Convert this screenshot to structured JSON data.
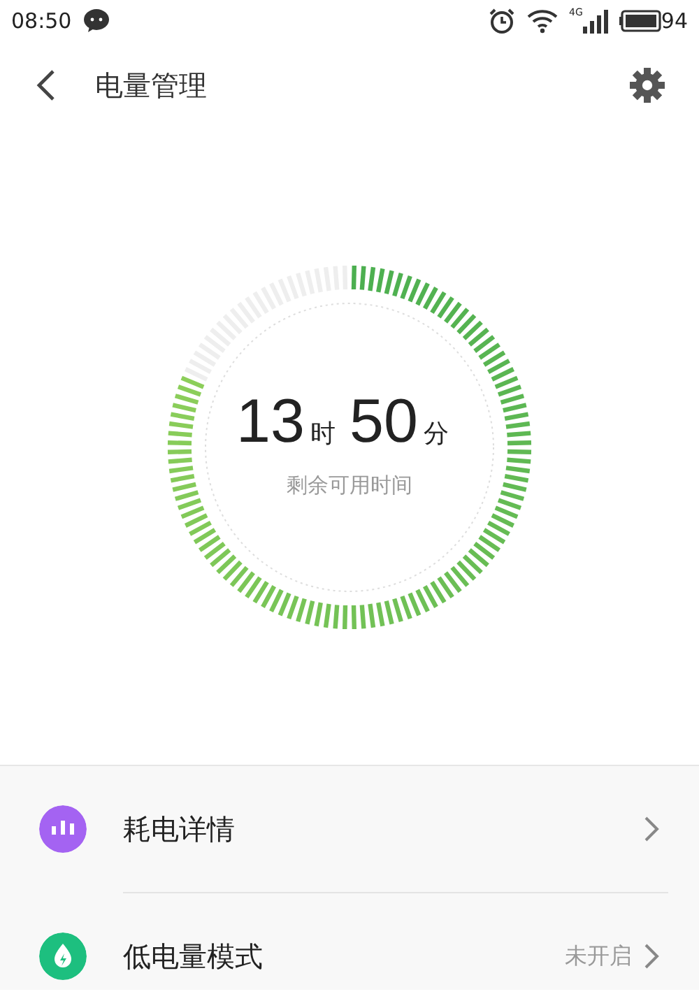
{
  "status_bar": {
    "time": "08:50",
    "network": "4G",
    "battery": "94"
  },
  "header": {
    "title": "电量管理"
  },
  "gauge": {
    "hours": "13",
    "hours_unit": "时",
    "minutes": "50",
    "minutes_unit": "分",
    "caption": "剩余可用时间"
  },
  "menu": [
    {
      "kind": "details",
      "label": "耗电详情",
      "color": "#a463f2"
    },
    {
      "kind": "mode",
      "label": "低电量模式",
      "value": "未开启",
      "color": "#1dbf7f"
    }
  ]
}
